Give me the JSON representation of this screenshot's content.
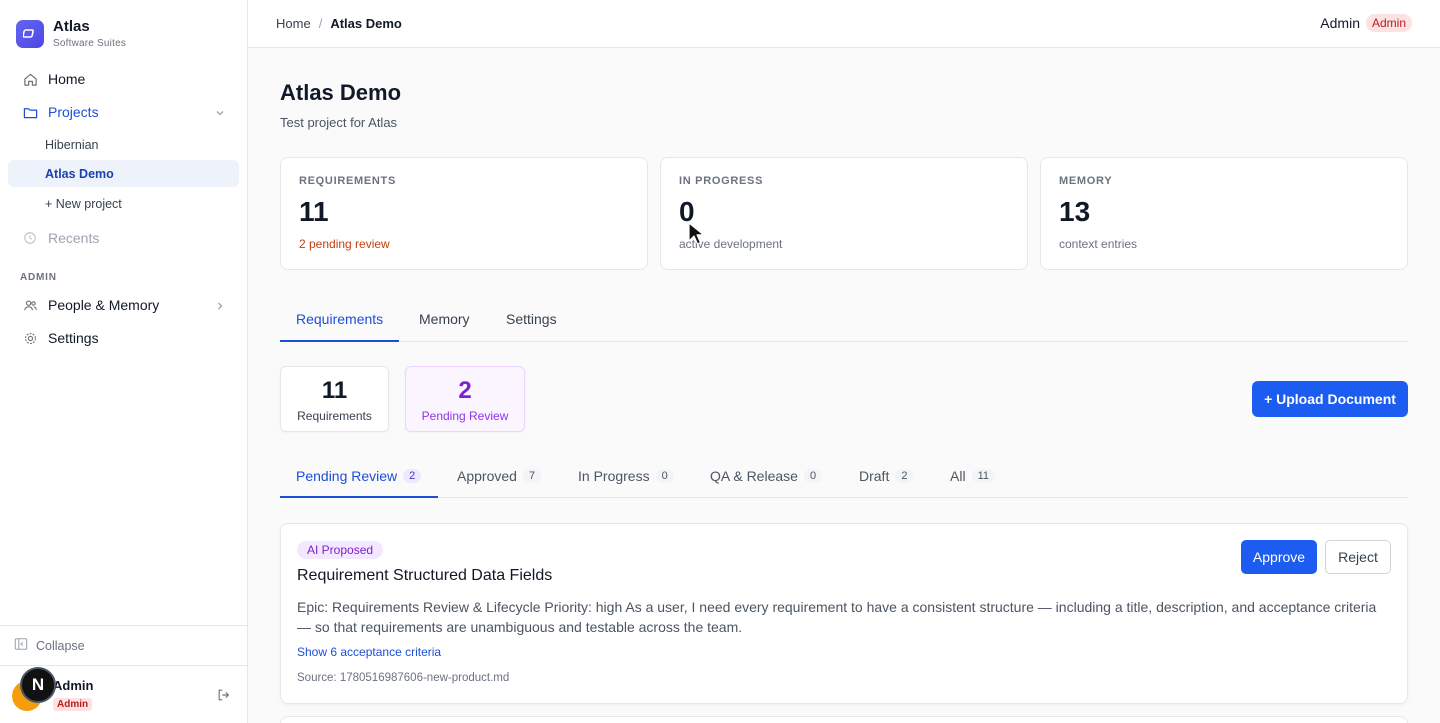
{
  "brand": {
    "name": "Atlas",
    "subtitle": "Software Suites"
  },
  "sidebar": {
    "home": "Home",
    "projects": "Projects",
    "project_items": [
      "Hibernian",
      "Atlas Demo",
      "+ New project"
    ],
    "recents": "Recents",
    "admin_section": "ADMIN",
    "people_memory": "People & Memory",
    "settings": "Settings",
    "collapse": "Collapse",
    "user": {
      "name": "Admin",
      "role": "Admin",
      "avatar_initial": "N"
    }
  },
  "topbar": {
    "breadcrumb": {
      "home": "Home",
      "separator": "/",
      "current": "Atlas Demo"
    },
    "user_name": "Admin",
    "user_role": "Admin"
  },
  "page": {
    "title": "Atlas Demo",
    "subtitle": "Test project for Atlas"
  },
  "stats": [
    {
      "label": "REQUIREMENTS",
      "value": "11",
      "sub": "2 pending review"
    },
    {
      "label": "IN PROGRESS",
      "value": "0",
      "sub": "active development"
    },
    {
      "label": "MEMORY",
      "value": "13",
      "sub": "context entries"
    }
  ],
  "main_tabs": [
    "Requirements",
    "Memory",
    "Settings"
  ],
  "summary": {
    "requirements": {
      "value": "11",
      "label": "Requirements"
    },
    "pending": {
      "value": "2",
      "label": "Pending Review"
    }
  },
  "upload_button": "+ Upload Document",
  "filter_tabs": [
    {
      "label": "Pending Review",
      "count": "2"
    },
    {
      "label": "Approved",
      "count": "7"
    },
    {
      "label": "In Progress",
      "count": "0"
    },
    {
      "label": "QA & Release",
      "count": "0"
    },
    {
      "label": "Draft",
      "count": "2"
    },
    {
      "label": "All",
      "count": "11"
    }
  ],
  "card": {
    "badge": "AI Proposed",
    "title": "Requirement Structured Data Fields",
    "description": "Epic: Requirements Review & Lifecycle Priority: high As a user, I need every requirement to have a consistent structure — including a title, description, and acceptance criteria — so that requirements are unambiguous and testable across the team.",
    "link": "Show 6 acceptance criteria",
    "source": "Source: 1780516987606-new-product.md",
    "approve": "Approve",
    "reject": "Reject"
  },
  "colors": {
    "accent": "#1d5cf0",
    "pending_purple": "#7e22ce",
    "warning": "#c2410c"
  }
}
